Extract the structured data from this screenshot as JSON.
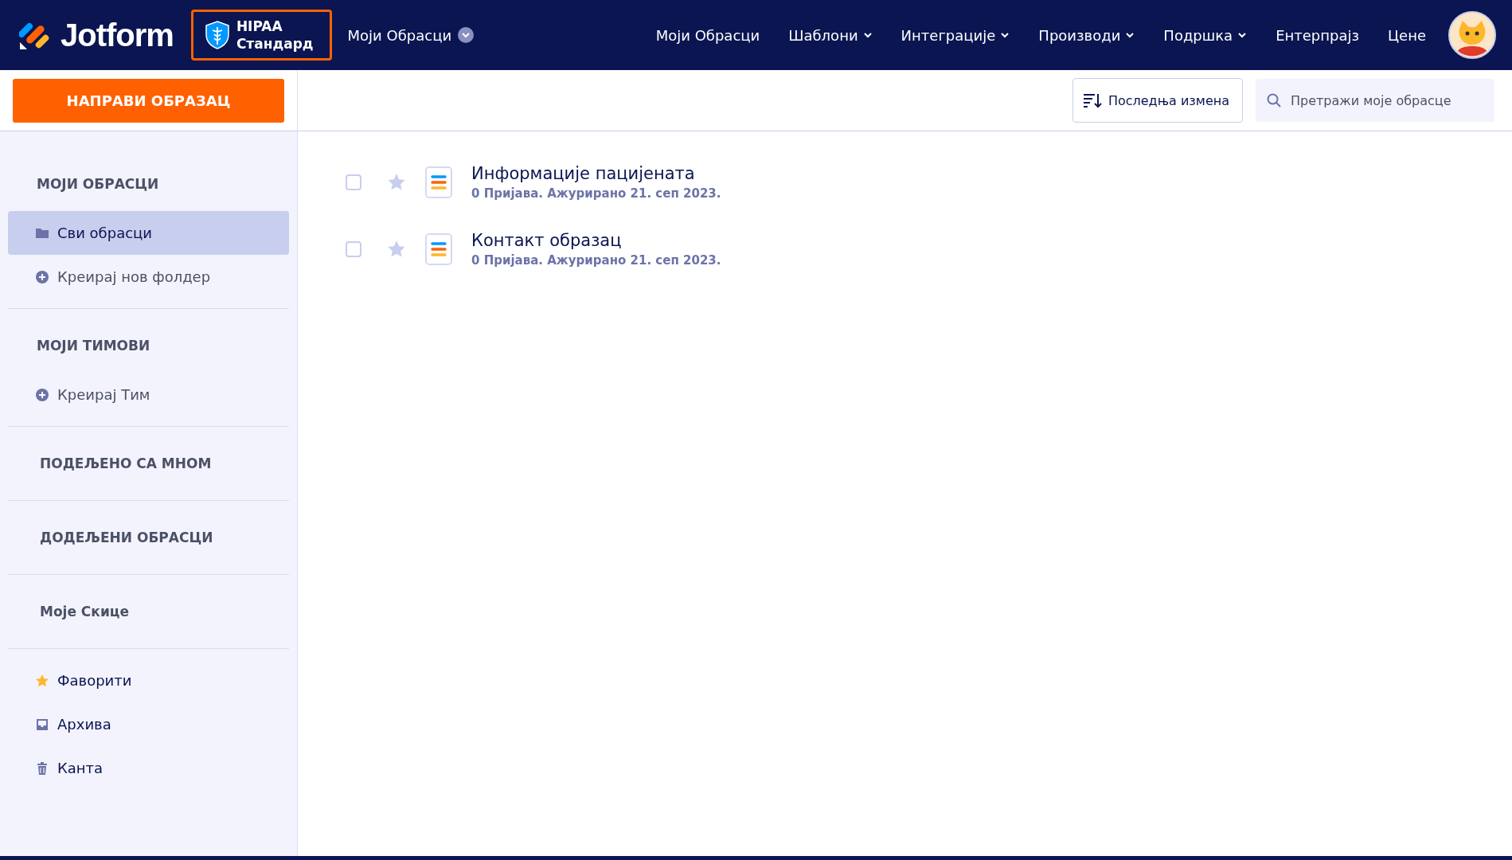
{
  "header": {
    "logo": "Jotform",
    "badge": {
      "line1": "HIPAA",
      "line2": "Стандард"
    },
    "forms_menu": "Моји Обрасци",
    "nav": [
      {
        "label": "Моји Обрасци",
        "dropdown": false
      },
      {
        "label": "Шаблони",
        "dropdown": true
      },
      {
        "label": "Интеграције",
        "dropdown": true
      },
      {
        "label": "Производи",
        "dropdown": true
      },
      {
        "label": "Подршка",
        "dropdown": true
      },
      {
        "label": "Ентерпрајз",
        "dropdown": false
      },
      {
        "label": "Цене",
        "dropdown": false
      }
    ]
  },
  "create_button": "НАПРАВИ ОБРАЗАЦ",
  "toolbar": {
    "sort_button": "Последња измена",
    "search": {
      "placeholder": "Претражи моје обрасце"
    }
  },
  "sidebar": {
    "sections": [
      {
        "title": "МОЈИ ОБРАСЦИ",
        "items": [
          {
            "label": "Сви обрасци",
            "kind": "folder",
            "selected": true
          },
          {
            "label": "Креирај нов фолдер",
            "kind": "plus",
            "selected": false
          }
        ]
      },
      {
        "title": "МОЈИ ТИМОВИ",
        "items": [
          {
            "label": "Креирај Тим",
            "kind": "plus",
            "selected": false
          }
        ]
      },
      {
        "title": "ПОДЕЉЕНО СА МНОМ"
      },
      {
        "title": "ДОДЕЉЕНИ ОБРАСЦИ"
      },
      {
        "title": "Моје Скице"
      },
      {
        "items": [
          {
            "label": "Фаворити",
            "kind": "star",
            "selected": false
          },
          {
            "label": "Архива",
            "kind": "inbox",
            "selected": false
          },
          {
            "label": "Канта",
            "kind": "trash",
            "selected": false
          }
        ]
      }
    ]
  },
  "forms": [
    {
      "title": "Информације пацијената",
      "meta": "0 Пријава. Ажурирано 21. сеп 2023.",
      "checked": false,
      "starred": false
    },
    {
      "title": "Контакт образац",
      "meta": "0 Пријава. Ажурирано 21. сеп 2023.",
      "checked": false,
      "starred": false
    }
  ]
}
